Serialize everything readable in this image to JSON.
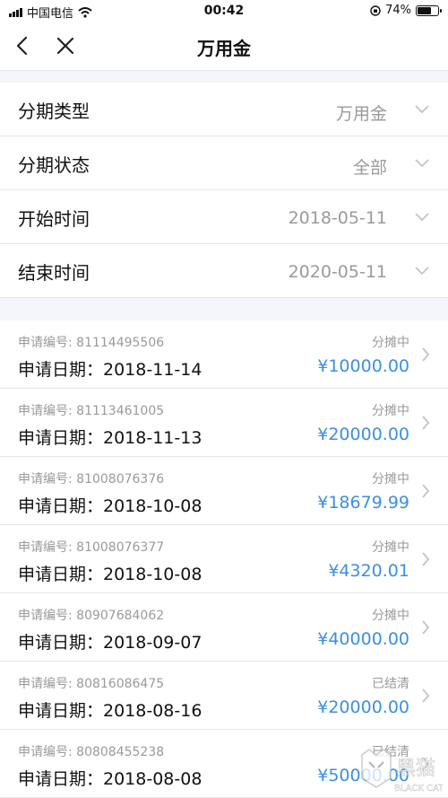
{
  "status_bar": {
    "carrier": "中国电信",
    "time": "00:42",
    "battery": "74%",
    "battery_level": 0.74
  },
  "nav": {
    "title": "万用金"
  },
  "filters": [
    {
      "label": "分期类型",
      "value": "万用金"
    },
    {
      "label": "分期状态",
      "value": "全部"
    },
    {
      "label": "开始时间",
      "value": "2018-05-11"
    },
    {
      "label": "结束时间",
      "value": "2020-05-11"
    }
  ],
  "records": [
    {
      "app_no": "申请编号: 81114495506",
      "date": "申请日期：2018-11-14",
      "status": "分摊中",
      "amount": "¥10000.00"
    },
    {
      "app_no": "申请编号: 81113461005",
      "date": "申请日期：2018-11-13",
      "status": "分摊中",
      "amount": "¥20000.00"
    },
    {
      "app_no": "申请编号: 81008076376",
      "date": "申请日期：2018-10-08",
      "status": "分摊中",
      "amount": "¥18679.99"
    },
    {
      "app_no": "申请编号: 81008076377",
      "date": "申请日期：2018-10-08",
      "status": "分摊中",
      "amount": "¥4320.01"
    },
    {
      "app_no": "申请编号: 80907684062",
      "date": "申请日期：2018-09-07",
      "status": "分摊中",
      "amount": "¥40000.00"
    },
    {
      "app_no": "申请编号: 80816086475",
      "date": "申请日期：2018-08-16",
      "status": "已结清",
      "amount": "¥20000.00"
    },
    {
      "app_no": "申请编号: 80808455238",
      "date": "申请日期：2018-08-08",
      "status": "已结清",
      "amount": "¥50000.00"
    }
  ],
  "colors": {
    "accent": "#3d8fe0",
    "muted": "#9a9a9a",
    "background": "#f4f6f9"
  },
  "icons": {
    "back": "chevron-left-icon",
    "close": "close-icon",
    "dropdown": "chevron-down-icon",
    "row": "chevron-right-icon"
  },
  "watermark": {
    "text": "BLACK CAT"
  }
}
